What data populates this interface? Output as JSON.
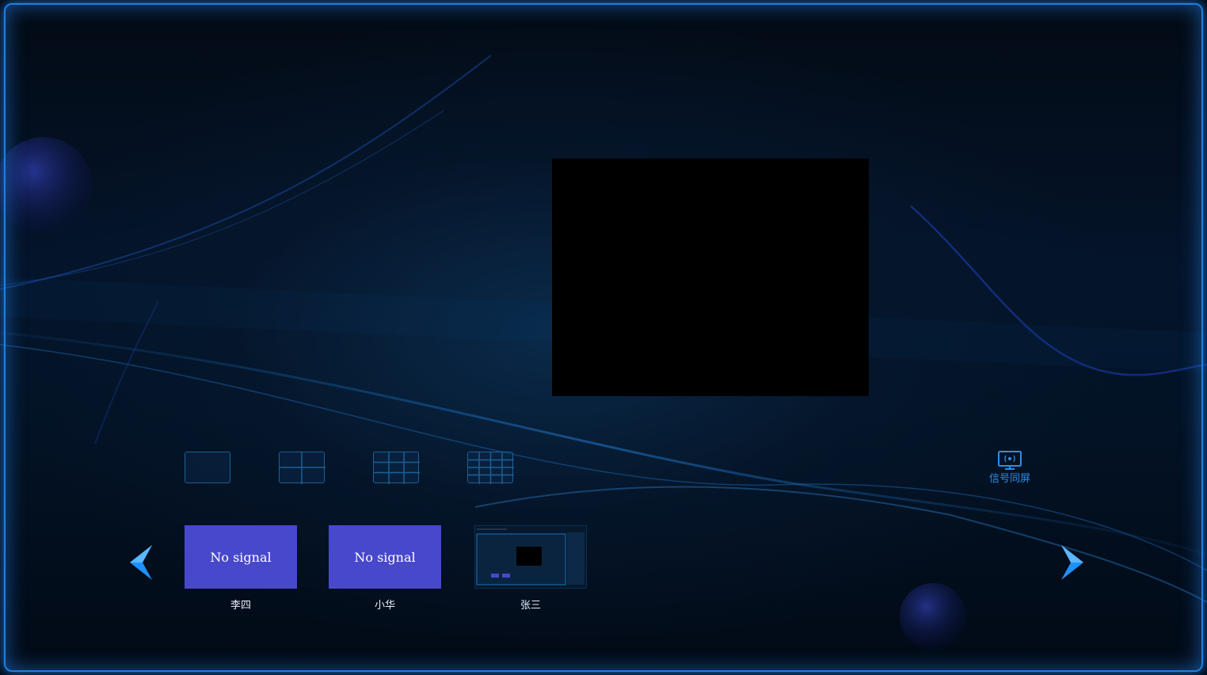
{
  "layouts": [
    {
      "name": "single"
    },
    {
      "name": "quad"
    },
    {
      "name": "nine"
    },
    {
      "name": "sixteen"
    }
  ],
  "sync_button": {
    "label": "信号同屏",
    "icon": "monitor-sync-icon"
  },
  "sources": [
    {
      "name": "李四",
      "status": "No signal"
    },
    {
      "name": "小华",
      "status": "No signal"
    },
    {
      "name": "张三",
      "status": ""
    }
  ],
  "colors": {
    "accent": "#1e7fe0",
    "tile": "#4848cc",
    "label": "#2b8fe8"
  }
}
